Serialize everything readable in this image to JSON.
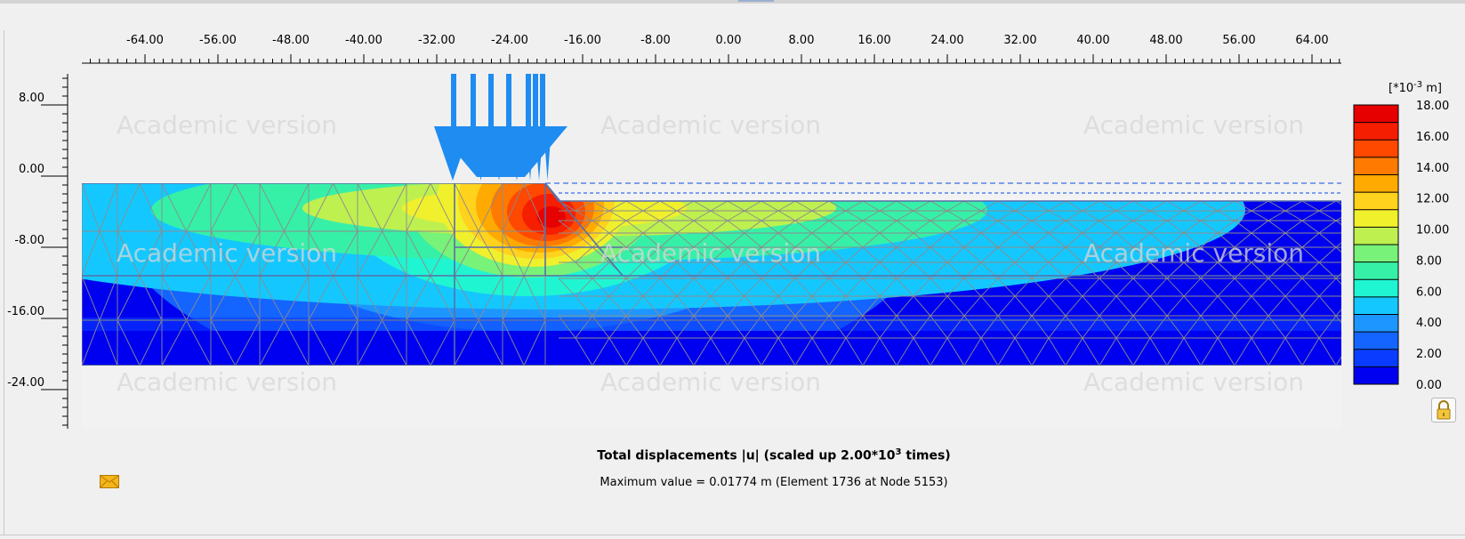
{
  "window": {
    "colors": {
      "background": "#f0f0f0",
      "load_arrow": "#1e8cf0",
      "mesh_line": "#8c8c8c"
    }
  },
  "plot": {
    "x_axis": {
      "ticks": [
        "-64.00",
        "-56.00",
        "-48.00",
        "-40.00",
        "-32.00",
        "-24.00",
        "-16.00",
        "-8.00",
        "0.00",
        "8.00",
        "16.00",
        "24.00",
        "32.00",
        "40.00",
        "48.00",
        "56.00",
        "64.00"
      ]
    },
    "y_axis": {
      "ticks": [
        "8.00",
        "0.00",
        "-8.00",
        "-16.00",
        "-24.00"
      ]
    },
    "watermark": "Academic version",
    "geometry_icons": [
      "distributed-load-arrows",
      "finite-element-mesh",
      "excavation-slope",
      "water-level-line"
    ]
  },
  "legend": {
    "unit_label": {
      "prefix": "[*10",
      "exponent": "-3",
      "suffix": " m]"
    },
    "labels": [
      "18.00",
      "16.00",
      "14.00",
      "12.00",
      "10.00",
      "8.00",
      "6.00",
      "4.00",
      "2.00",
      "0.00"
    ],
    "colors": [
      "#0000f0",
      "#0a3cff",
      "#1464ff",
      "#1e96ff",
      "#14c8ff",
      "#20f5d2",
      "#36f0a8",
      "#78f278",
      "#bef050",
      "#f0f02d",
      "#ffd21e",
      "#ffaa00",
      "#ff7a00",
      "#ff4800",
      "#f51e00",
      "#e60000"
    ]
  },
  "caption": {
    "title_prefix": "Total displacements |u| (scaled up 2.00*10",
    "title_exponent": "3",
    "title_suffix": " times)",
    "max_value": "Maximum value = 0.01774 m (Element 1736 at Node 5153)"
  },
  "icons": {
    "envelope": "envelope-icon",
    "lock": "lock-icon"
  }
}
